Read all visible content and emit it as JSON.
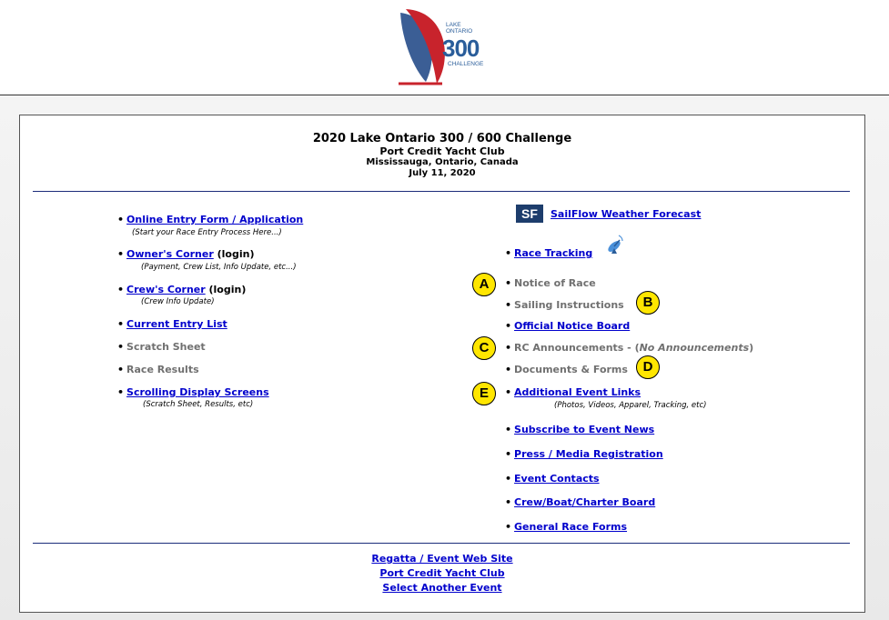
{
  "header": {
    "logo": {
      "lake": "LAKE",
      "ontario": "ONTARIO",
      "number": "300",
      "challenge": "CHALLENGE"
    }
  },
  "event": {
    "title": "2020 Lake Ontario 300 / 600 Challenge",
    "club": "Port Credit Yacht Club",
    "location": "Mississauga, Ontario, Canada",
    "date": "July 11, 2020"
  },
  "left": {
    "online_entry": {
      "label": "Online Entry Form / Application",
      "sub": "(Start your Race Entry Process Here...)"
    },
    "owners_corner": {
      "label": "Owner's Corner",
      "suffix": " (login)",
      "sub": "(Payment, Crew List, Info Update, etc...)"
    },
    "crews_corner": {
      "label": "Crew's Corner",
      "suffix": " (login)",
      "sub": "(Crew Info Update)"
    },
    "current_entry": "Current Entry List",
    "scratch_sheet": "Scratch Sheet",
    "race_results": "Race Results",
    "scrolling": {
      "label": "Scrolling Display Screens",
      "sub": "(Scratch Sheet, Results, etc)"
    }
  },
  "right": {
    "sf_icon": "SF",
    "sailflow": "SailFlow Weather Forecast",
    "race_tracking": "Race Tracking",
    "notice_of_race": "Notice of Race",
    "sailing_instructions": "Sailing Instructions",
    "official_notice": "Official Notice Board",
    "rc_announcements": "RC Announcements - (",
    "rc_none": "No Announcements",
    "rc_close": ")",
    "documents": "Documents & Forms",
    "additional": {
      "label": "Additional Event Links",
      "sub": "(Photos, Videos, Apparel, Tracking, etc)"
    },
    "subscribe": "Subscribe to Event News",
    "press": "Press / Media Registration",
    "contacts": "Event Contacts",
    "crew_board": "Crew/Boat/Charter Board",
    "general_forms": "General Race Forms"
  },
  "badges": {
    "a": "A",
    "b": "B",
    "c": "C",
    "d": "D",
    "e": "E"
  },
  "footer": {
    "regatta": "Regatta / Event Web Site",
    "club": "Port Credit Yacht Club",
    "select": "Select Another Event"
  },
  "colors": {
    "link": "#0000cc",
    "disabled": "#707070",
    "badge": "#ffe600",
    "rule": "#1b2c7a"
  }
}
